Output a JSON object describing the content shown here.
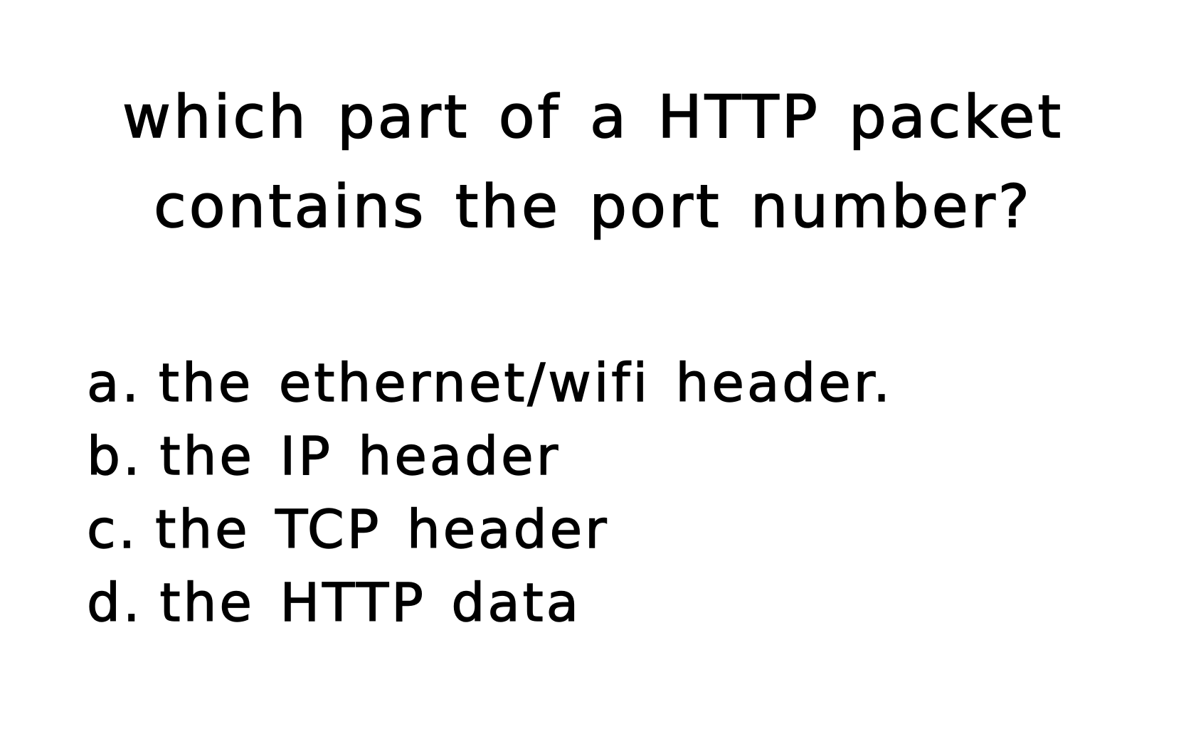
{
  "question": {
    "lines": [
      "which part of a HTTP packet",
      "contains the port number?"
    ]
  },
  "options": [
    {
      "letter": "a.",
      "text": "the ethernet/wifi header."
    },
    {
      "letter": "b.",
      "text": "the IP header"
    },
    {
      "letter": "c.",
      "text": "the TCP header"
    },
    {
      "letter": "d.",
      "text": "the HTTP data"
    }
  ],
  "colors": {
    "background": "#ffffff",
    "text": "#000000"
  }
}
